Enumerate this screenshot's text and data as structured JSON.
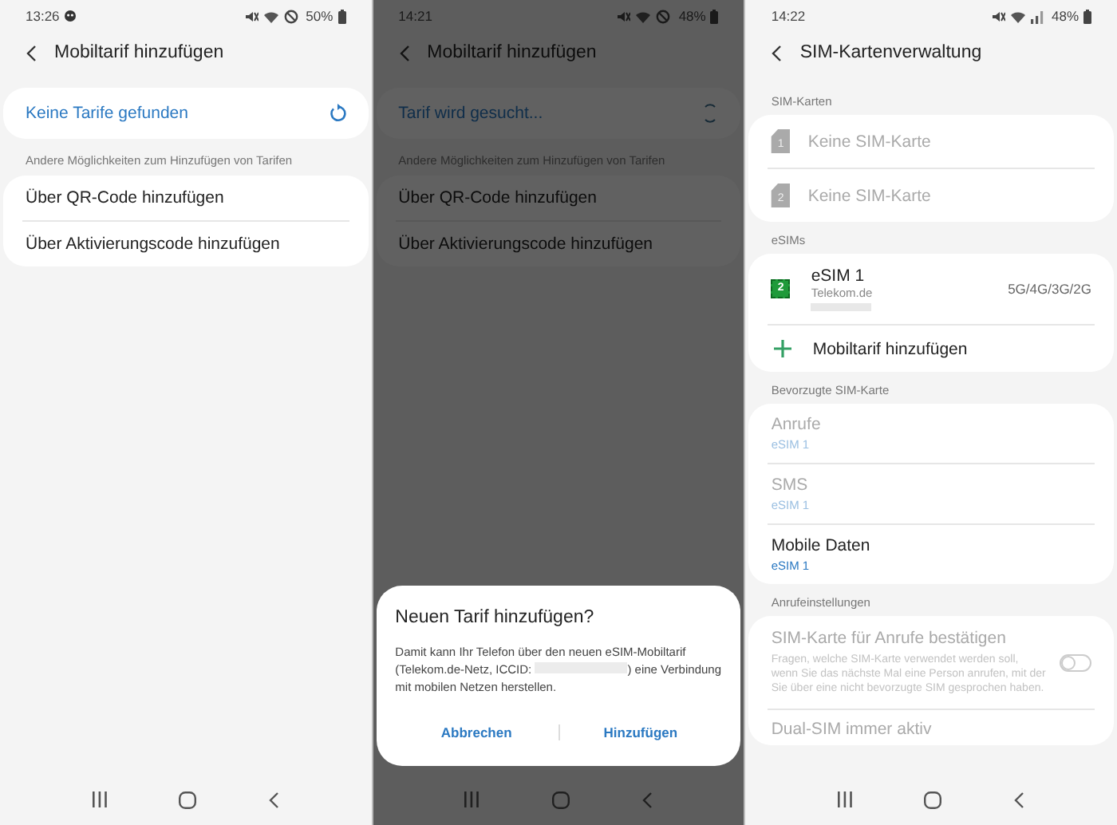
{
  "screens": [
    {
      "kind": "tariff",
      "status_bar": {
        "time": "13:26",
        "left_icons": [
          {
            "kind": "notification"
          }
        ],
        "icons": [
          {
            "kind": "mute"
          },
          {
            "kind": "wifi"
          },
          {
            "kind": "dnd"
          }
        ],
        "battery": "50%"
      },
      "header": {
        "title": "Mobiltarif hinzufügen"
      },
      "search": {
        "label": "Keine Tarife gefunden",
        "searching": false
      },
      "section_label": "Andere Möglichkeiten zum Hinzufügen von Tarifen",
      "options": [
        "Über QR-Code hinzufügen",
        "Über Aktivierungscode hinzufügen"
      ]
    },
    {
      "kind": "tariff",
      "status_bar": {
        "time": "14:21",
        "icons": [
          {
            "kind": "mute"
          },
          {
            "kind": "wifi"
          },
          {
            "kind": "dnd"
          }
        ],
        "battery": "48%"
      },
      "header": {
        "title": "Mobiltarif hinzufügen"
      },
      "search": {
        "label": "Tarif wird gesucht...",
        "searching": true
      },
      "section_label": "Andere Möglichkeiten zum Hinzufügen von Tarifen",
      "options": [
        "Über QR-Code hinzufügen",
        "Über Aktivierungscode hinzufügen"
      ],
      "dialog": {
        "title": "Neuen Tarif hinzufügen?",
        "text_before": "Damit kann Ihr Telefon über den neuen eSIM-Mobiltarif (Telekom.de-Netz, ICCID:",
        "text_after": ") eine Verbindung mit mobilen Netzen herstellen.",
        "buttons": [
          "Abbrechen",
          "Hinzufügen"
        ]
      }
    },
    {
      "kind": "sim_manager",
      "status_bar": {
        "time": "14:22",
        "icons": [
          {
            "kind": "mute"
          },
          {
            "kind": "wifi"
          },
          {
            "kind": "signal"
          }
        ],
        "battery": "48%"
      },
      "header": {
        "title": "SIM-Kartenverwaltung"
      },
      "sections": [
        {
          "label": "SIM-Karten",
          "items": [
            {
              "kind": "sim",
              "slot": "1",
              "title": "Keine SIM-Karte",
              "disabled": true
            },
            {
              "kind": "sim",
              "slot": "2",
              "title": "Keine SIM-Karte",
              "disabled": true
            }
          ]
        },
        {
          "label": "eSIMs",
          "items": [
            {
              "kind": "esim",
              "slot": "2",
              "title": "eSIM 1",
              "subtitle": "Telekom.de",
              "networks": "5G/4G/3G/2G"
            },
            {
              "kind": "add",
              "title": "Mobiltarif hinzufügen"
            }
          ]
        },
        {
          "label": "Bevorzugte SIM-Karte",
          "items": [
            {
              "kind": "pref",
              "title": "Anrufe",
              "value": "eSIM 1",
              "disabled": true
            },
            {
              "kind": "pref",
              "title": "SMS",
              "value": "eSIM 1",
              "disabled": true
            },
            {
              "kind": "pref",
              "title": "Mobile Daten",
              "value": "eSIM 1",
              "disabled": false
            }
          ]
        },
        {
          "label": "Anrufeinstellungen",
          "items": [
            {
              "kind": "toggle",
              "title": "SIM-Karte für Anrufe bestätigen",
              "description": "Fragen, welche SIM-Karte verwendet werden soll, wenn Sie das nächste Mal eine Person anrufen, mit der Sie über eine nicht bevorzugte SIM gesprochen haben.",
              "on": false,
              "disabled": true
            },
            {
              "kind": "pref",
              "title": "Dual-SIM immer aktiv",
              "disabled": true
            }
          ]
        }
      ]
    }
  ]
}
